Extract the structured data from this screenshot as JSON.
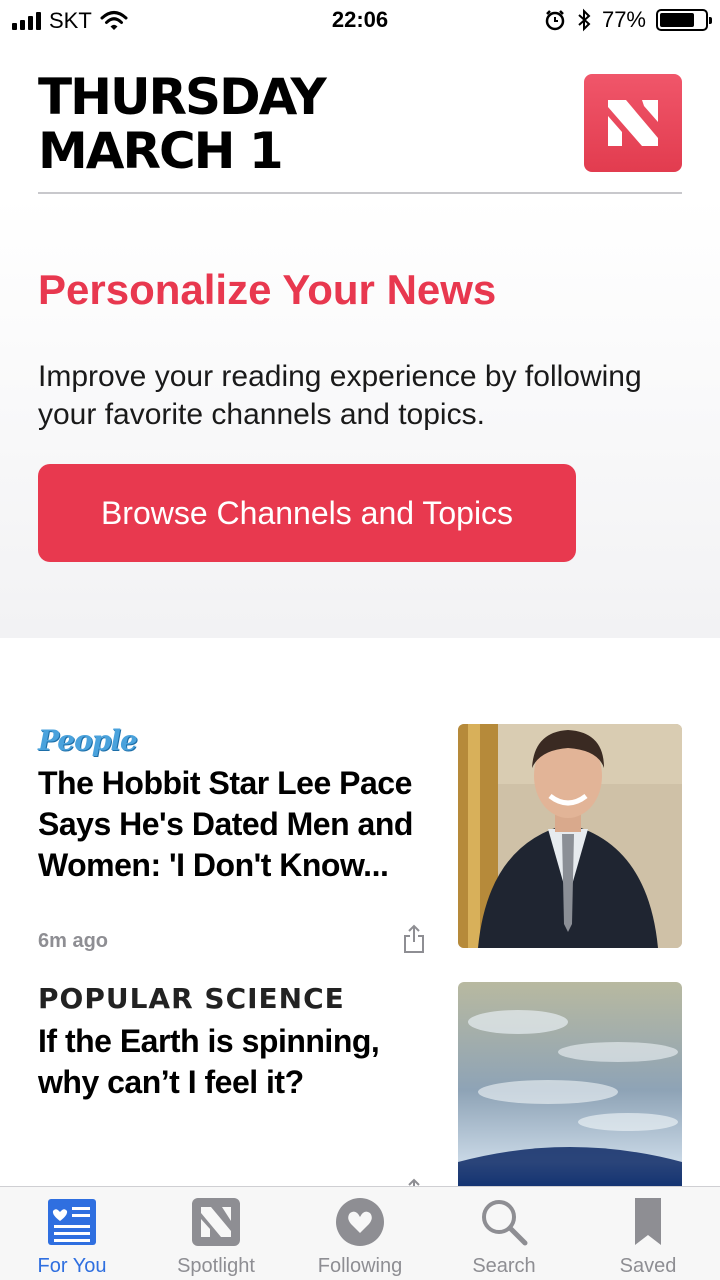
{
  "status_bar": {
    "carrier": "SKT",
    "time": "22:06",
    "battery": "77%",
    "battery_level": 0.77
  },
  "header": {
    "day": "THURSDAY",
    "date": "MARCH 1"
  },
  "promo": {
    "title": "Personalize Your News",
    "text": "Improve your reading experience by following your favorite channels and topics.",
    "button_label": "Browse Channels and Topics"
  },
  "feed": {
    "articles": [
      {
        "publisher": "People",
        "headline": "The Hobbit Star Lee Pace Says He's Dated Men and Women: 'I Don't Know...",
        "time": "6m ago"
      },
      {
        "publisher": "POPULAR SCIENCE",
        "headline": "If the Earth is spinning, why can’t I feel it?"
      }
    ]
  },
  "tabs": [
    {
      "label": "For You",
      "icon": "for-you-icon",
      "active": true
    },
    {
      "label": "Spotlight",
      "icon": "spotlight-icon",
      "active": false
    },
    {
      "label": "Following",
      "icon": "heart-icon",
      "active": false
    },
    {
      "label": "Search",
      "icon": "search-icon",
      "active": false
    },
    {
      "label": "Saved",
      "icon": "bookmark-icon",
      "active": false
    }
  ],
  "colors": {
    "accent": "#e8394f",
    "tab_active": "#2f6fe0",
    "tab_inactive": "#8e8e93"
  }
}
